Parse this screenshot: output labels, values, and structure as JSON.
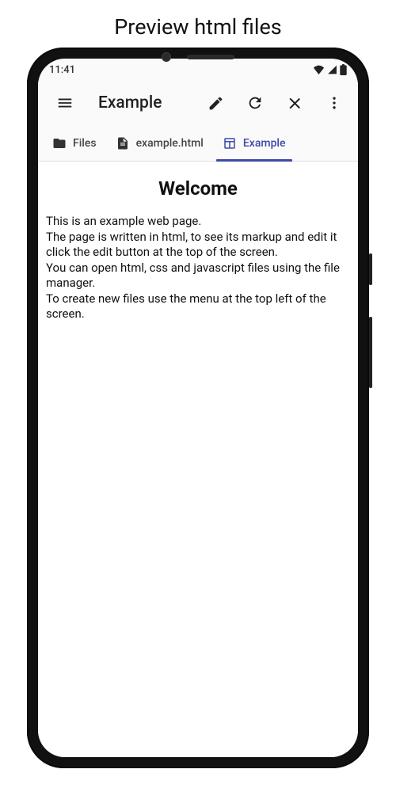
{
  "caption": "Preview html files",
  "statusbar": {
    "time": "11:41"
  },
  "appbar": {
    "title": "Example"
  },
  "tabs": {
    "files": "Files",
    "file": "example.html",
    "preview": "Example"
  },
  "content": {
    "heading": "Welcome",
    "body": "This is an example web page.\nThe page is written in html, to see its markup and edit it click the edit button at the top of the screen.\nYou can open html, css and javascript files using the file manager.\nTo create new files use the menu at the top left of the screen."
  }
}
